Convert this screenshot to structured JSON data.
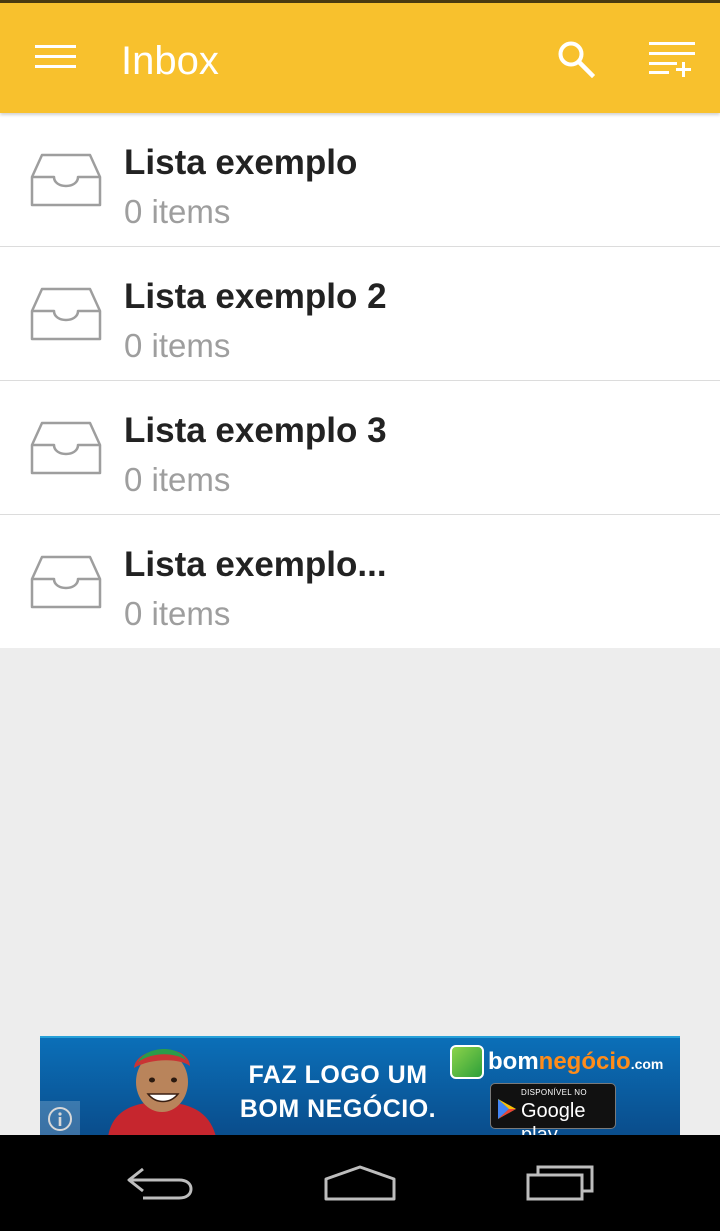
{
  "appbar": {
    "title": "Inbox",
    "menu_icon": "hamburger-menu-icon",
    "search_icon": "search-icon",
    "add_list_icon": "playlist-add-icon",
    "color": "#f8c12d"
  },
  "lists": [
    {
      "name": "Lista exemplo",
      "count": "0 items",
      "icon": "inbox-tray-icon"
    },
    {
      "name": "Lista exemplo 2",
      "count": "0 items",
      "icon": "inbox-tray-icon"
    },
    {
      "name": "Lista exemplo 3",
      "count": "0 items",
      "icon": "inbox-tray-icon"
    },
    {
      "name": "Lista exemplo...",
      "count": "0 items",
      "icon": "inbox-tray-icon"
    }
  ],
  "ad": {
    "slogan": "FAZ LOGO UM BOM NEGÓCIO.",
    "brand_bom": "bom",
    "brand_negocio": "negócio",
    "brand_domain": ".com",
    "store_small": "DISPONÍVEL NO",
    "store_big": "Google play",
    "info_icon": "info-icon"
  },
  "navbar": {
    "back_icon": "back-icon",
    "home_icon": "home-icon",
    "recents_icon": "recents-icon"
  }
}
